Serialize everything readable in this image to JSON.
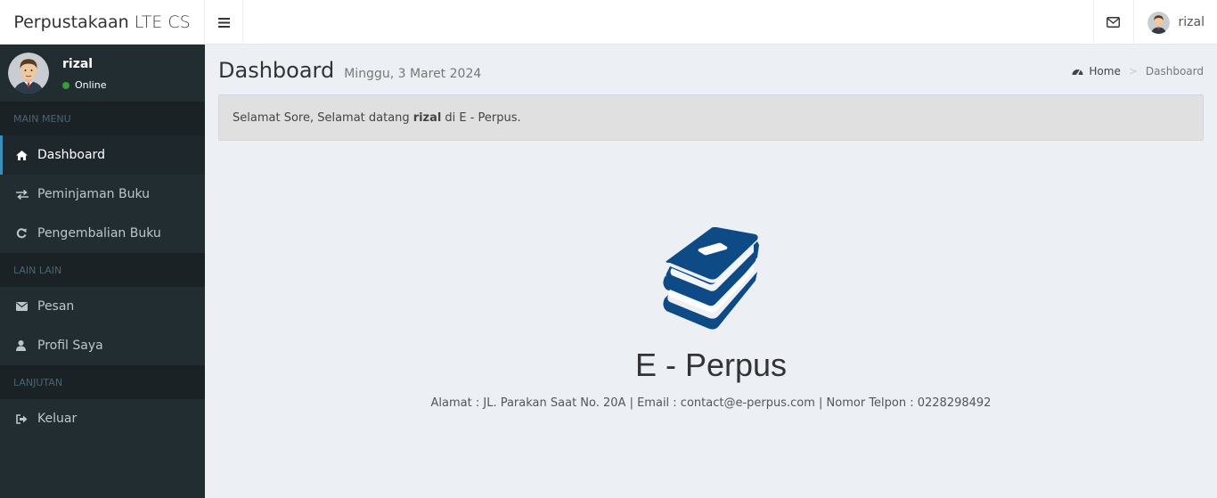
{
  "brand": {
    "main": "Perpustakaan",
    "lite": "LTE CS"
  },
  "navbar": {
    "username": "rizal"
  },
  "sidebar": {
    "user": {
      "name": "rizal",
      "status": "Online"
    },
    "headers": [
      "MAIN MENU",
      "LAIN LAIN",
      "LANJUTAN"
    ],
    "items": [
      {
        "label": "Dashboard",
        "icon": "home-icon",
        "active": true
      },
      {
        "label": "Peminjaman Buku",
        "icon": "exchange-icon"
      },
      {
        "label": "Pengembalian Buku",
        "icon": "refresh-icon"
      },
      {
        "label": "Pesan",
        "icon": "envelope-icon"
      },
      {
        "label": "Profil Saya",
        "icon": "user-icon"
      },
      {
        "label": "Keluar",
        "icon": "sign-out-icon"
      }
    ]
  },
  "page": {
    "title": "Dashboard",
    "subtitle": "Minggu, 3 Maret 2024"
  },
  "breadcrumb": {
    "home": "Home",
    "current": "Dashboard"
  },
  "greeting": {
    "prefix": "Selamat Sore, Selamat datang",
    "name": "rizal",
    "suffix": "di E - Perpus."
  },
  "hero": {
    "title": "E - Perpus",
    "info": "Alamat : JL. Parakan Saat No. 20A | Email : contact@e-perpus.com | Nomor Telpon : 0228298492"
  },
  "colors": {
    "sidebar": "#222d32",
    "sidebar_header": "#1a2226",
    "book": "#0d4a86",
    "content_bg": "#ecf0f5"
  }
}
